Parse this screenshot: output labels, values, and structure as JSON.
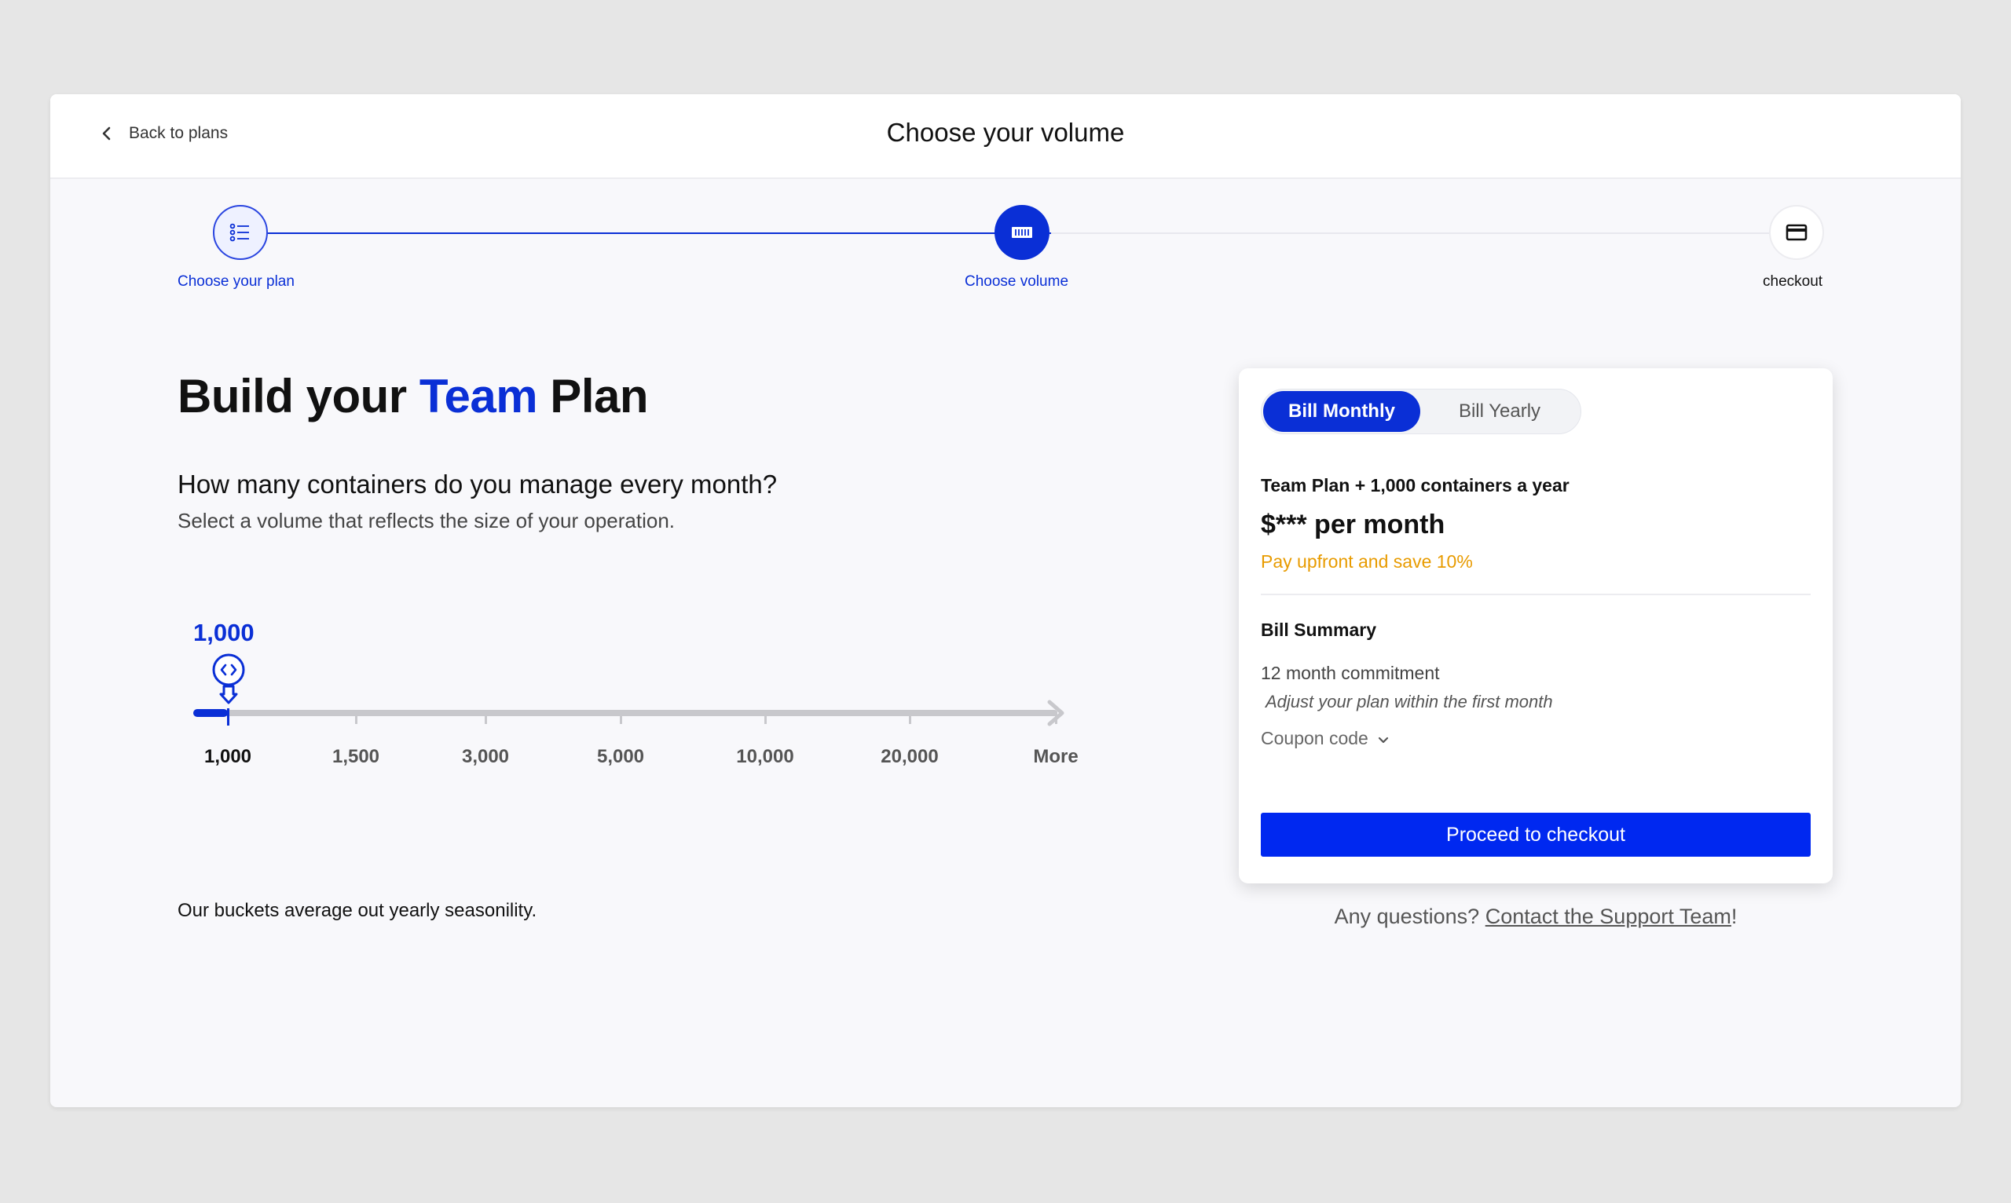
{
  "header": {
    "back_label": "Back to plans",
    "title": "Choose your volume"
  },
  "stepper": {
    "steps": [
      {
        "label": "Choose your plan",
        "icon": "list-icon",
        "state": "complete"
      },
      {
        "label": "Choose volume",
        "icon": "container-icon",
        "state": "active"
      },
      {
        "label": "checkout",
        "icon": "credit-card-icon",
        "state": "upcoming"
      }
    ]
  },
  "main": {
    "headline_pre": "Build your ",
    "headline_accent": "Team",
    "headline_post": " Plan",
    "question": "How many containers do you manage every month?",
    "helper": "Select a volume that reflects the size of your operation.",
    "note": "Our buckets average out yearly seasonility."
  },
  "slider": {
    "current_value": "1,000",
    "selected_index": 0,
    "options": [
      "1,000",
      "1,500",
      "3,000",
      "5,000",
      "10,000",
      "20,000",
      "More"
    ]
  },
  "card": {
    "billing_options": {
      "monthly": "Bill Monthly",
      "yearly": "Bill Yearly",
      "selected": "monthly"
    },
    "plan_name": "Team Plan + 1,000 containers a year",
    "price": "$*** per month",
    "save_text": "Pay upfront and save 10%",
    "summary_title": "Bill Summary",
    "commitment": "12 month commitment",
    "adjust_text": "Adjust your plan within the first month",
    "coupon_label": "Coupon code",
    "checkout_label": "Proceed to checkout"
  },
  "support": {
    "prefix": "Any questions? ",
    "link": "Contact the Support Team",
    "suffix": "!"
  },
  "colors": {
    "accent": "#0a2fd6",
    "button": "#0028f0",
    "save": "#e89b00",
    "background": "#e6e6e6"
  }
}
